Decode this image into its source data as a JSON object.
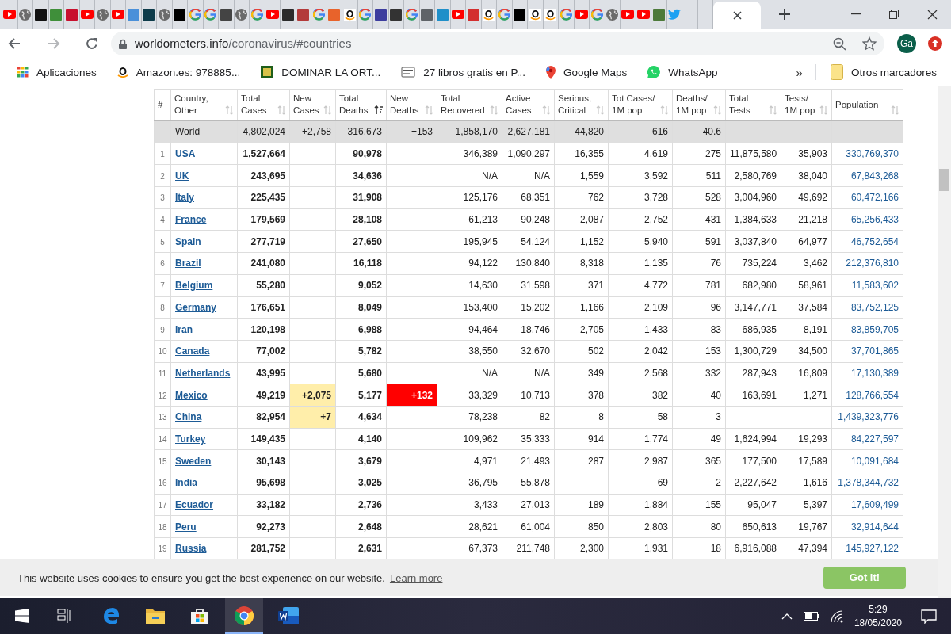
{
  "tabs": [
    {
      "kind": "youtube",
      "selected": false
    },
    {
      "kind": "globe",
      "selected": false
    },
    {
      "kind": "square",
      "color": "#111111",
      "selected": false
    },
    {
      "kind": "square",
      "color": "#3f8f3a",
      "selected": false
    },
    {
      "kind": "square",
      "color": "#c8102e",
      "selected": false
    },
    {
      "kind": "youtube",
      "selected": false
    },
    {
      "kind": "globe",
      "selected": false
    },
    {
      "kind": "youtube",
      "selected": false
    },
    {
      "kind": "square",
      "color": "#4a90d9",
      "selected": false
    },
    {
      "kind": "square",
      "color": "#0d3b4a",
      "selected": false
    },
    {
      "kind": "globe",
      "selected": false
    },
    {
      "kind": "square",
      "color": "#000000",
      "selected": false
    },
    {
      "kind": "google",
      "selected": false
    },
    {
      "kind": "google",
      "selected": false
    },
    {
      "kind": "square",
      "color": "#444444",
      "selected": false
    },
    {
      "kind": "globe",
      "selected": false
    },
    {
      "kind": "google",
      "selected": false
    },
    {
      "kind": "youtube",
      "selected": false
    },
    {
      "kind": "square",
      "color": "#2b2b2b",
      "selected": false
    },
    {
      "kind": "square",
      "color": "#b33a3a",
      "selected": false
    },
    {
      "kind": "google",
      "selected": false
    },
    {
      "kind": "square",
      "color": "#e8632b",
      "selected": false
    },
    {
      "kind": "amazon",
      "selected": false
    },
    {
      "kind": "google",
      "selected": false
    },
    {
      "kind": "square",
      "color": "#3d3d9e",
      "selected": false
    },
    {
      "kind": "square",
      "color": "#333333",
      "selected": false
    },
    {
      "kind": "google",
      "selected": false
    },
    {
      "kind": "square",
      "color": "#5f6368",
      "selected": false
    },
    {
      "kind": "square",
      "color": "#1f8fc9",
      "selected": false
    },
    {
      "kind": "youtube",
      "selected": false
    },
    {
      "kind": "square",
      "color": "#d32f2f",
      "selected": false
    },
    {
      "kind": "amazon",
      "selected": false
    },
    {
      "kind": "google",
      "selected": false
    },
    {
      "kind": "square",
      "color": "#000000",
      "selected": false
    },
    {
      "kind": "amazon",
      "selected": false
    },
    {
      "kind": "amazon",
      "selected": false
    },
    {
      "kind": "google",
      "selected": false
    },
    {
      "kind": "youtube",
      "selected": false
    },
    {
      "kind": "google",
      "selected": false
    },
    {
      "kind": "globe",
      "selected": false
    },
    {
      "kind": "youtube",
      "selected": false
    },
    {
      "kind": "youtube",
      "selected": false
    },
    {
      "kind": "square",
      "color": "#4d7a3a",
      "selected": false
    },
    {
      "kind": "twitter",
      "selected": false
    },
    {
      "kind": "blank",
      "selected": false
    },
    {
      "kind": "blank",
      "selected": false
    },
    {
      "kind": "blank",
      "selected": true
    }
  ],
  "address": {
    "host": "worldometers.info",
    "path": "/coronavirus/#countries"
  },
  "profile": "Ga",
  "bookmarks": [
    {
      "kind": "apps",
      "label": "Aplicaciones"
    },
    {
      "kind": "amazon",
      "label": "Amazon.es: 978885..."
    },
    {
      "kind": "book",
      "label": "DOMINAR LA ORT..."
    },
    {
      "kind": "ebook",
      "label": "27 libros gratis en P..."
    },
    {
      "kind": "maps",
      "label": "Google Maps"
    },
    {
      "kind": "whatsapp",
      "label": "WhatsApp"
    }
  ],
  "more_bookmarks": "»",
  "other_bookmarks": "Otros marcadores",
  "table": {
    "columns": [
      {
        "label": "#",
        "sorted": false
      },
      {
        "label": "Country,\nOther",
        "sorted": false
      },
      {
        "label": "Total\nCases",
        "sorted": false
      },
      {
        "label": "New\nCases",
        "sorted": false
      },
      {
        "label": "Total\nDeaths",
        "sorted": true
      },
      {
        "label": "New\nDeaths",
        "sorted": false
      },
      {
        "label": "Total\nRecovered",
        "sorted": false
      },
      {
        "label": "Active\nCases",
        "sorted": false
      },
      {
        "label": "Serious,\nCritical",
        "sorted": false
      },
      {
        "label": "Tot Cases/\n1M pop",
        "sorted": false
      },
      {
        "label": "Deaths/\n1M pop",
        "sorted": false
      },
      {
        "label": "Total\nTests",
        "sorted": false
      },
      {
        "label": "Tests/\n1M pop",
        "sorted": false
      },
      {
        "label": "Population",
        "sorted": false
      }
    ],
    "rows": [
      {
        "kind": "total",
        "cells": [
          null,
          "World",
          "4,802,024",
          "+2,758",
          "316,673",
          "+153",
          "1,858,170",
          "2,627,181",
          "44,820",
          "616",
          "40.6",
          null,
          null,
          null
        ]
      },
      {
        "kind": "country",
        "cells": [
          "1",
          "USA",
          "1,527,664",
          null,
          "90,978",
          null,
          "346,389",
          "1,090,297",
          "16,355",
          "4,619",
          "275",
          "11,875,580",
          "35,903",
          "330,769,370"
        ]
      },
      {
        "kind": "country",
        "cells": [
          "2",
          "UK",
          "243,695",
          null,
          "34,636",
          null,
          "N/A",
          "N/A",
          "1,559",
          "3,592",
          "511",
          "2,580,769",
          "38,040",
          "67,843,268"
        ]
      },
      {
        "kind": "country",
        "cells": [
          "3",
          "Italy",
          "225,435",
          null,
          "31,908",
          null,
          "125,176",
          "68,351",
          "762",
          "3,728",
          "528",
          "3,004,960",
          "49,692",
          "60,472,166"
        ]
      },
      {
        "kind": "country",
        "cells": [
          "4",
          "France",
          "179,569",
          null,
          "28,108",
          null,
          "61,213",
          "90,248",
          "2,087",
          "2,752",
          "431",
          "1,384,633",
          "21,218",
          "65,256,433"
        ]
      },
      {
        "kind": "country",
        "cells": [
          "5",
          "Spain",
          "277,719",
          null,
          "27,650",
          null,
          "195,945",
          "54,124",
          "1,152",
          "5,940",
          "591",
          "3,037,840",
          "64,977",
          "46,752,654"
        ]
      },
      {
        "kind": "country",
        "cells": [
          "6",
          "Brazil",
          "241,080",
          null,
          "16,118",
          null,
          "94,122",
          "130,840",
          "8,318",
          "1,135",
          "76",
          "735,224",
          "3,462",
          "212,376,810"
        ]
      },
      {
        "kind": "country",
        "cells": [
          "7",
          "Belgium",
          "55,280",
          null,
          "9,052",
          null,
          "14,630",
          "31,598",
          "371",
          "4,772",
          "781",
          "682,980",
          "58,961",
          "11,583,602"
        ]
      },
      {
        "kind": "country",
        "cells": [
          "8",
          "Germany",
          "176,651",
          null,
          "8,049",
          null,
          "153,400",
          "15,202",
          "1,166",
          "2,109",
          "96",
          "3,147,771",
          "37,584",
          "83,752,125"
        ]
      },
      {
        "kind": "country",
        "cells": [
          "9",
          "Iran",
          "120,198",
          null,
          "6,988",
          null,
          "94,464",
          "18,746",
          "2,705",
          "1,433",
          "83",
          "686,935",
          "8,191",
          "83,859,705"
        ]
      },
      {
        "kind": "country",
        "cells": [
          "10",
          "Canada",
          "77,002",
          null,
          "5,782",
          null,
          "38,550",
          "32,670",
          "502",
          "2,042",
          "153",
          "1,300,729",
          "34,500",
          "37,701,865"
        ]
      },
      {
        "kind": "country",
        "cells": [
          "11",
          "Netherlands",
          "43,995",
          null,
          "5,680",
          null,
          "N/A",
          "N/A",
          "349",
          "2,568",
          "332",
          "287,943",
          "16,809",
          "17,130,389"
        ]
      },
      {
        "kind": "country",
        "cells": [
          "12",
          "Mexico",
          "49,219",
          "+2,075",
          "5,177",
          "+132",
          "33,329",
          "10,713",
          "378",
          "382",
          "40",
          "163,691",
          "1,271",
          "128,766,554"
        ]
      },
      {
        "kind": "country",
        "cells": [
          "13",
          "China",
          "82,954",
          "+7",
          "4,634",
          null,
          "78,238",
          "82",
          "8",
          "58",
          "3",
          null,
          null,
          "1,439,323,776"
        ]
      },
      {
        "kind": "country",
        "cells": [
          "14",
          "Turkey",
          "149,435",
          null,
          "4,140",
          null,
          "109,962",
          "35,333",
          "914",
          "1,774",
          "49",
          "1,624,994",
          "19,293",
          "84,227,597"
        ]
      },
      {
        "kind": "country",
        "cells": [
          "15",
          "Sweden",
          "30,143",
          null,
          "3,679",
          null,
          "4,971",
          "21,493",
          "287",
          "2,987",
          "365",
          "177,500",
          "17,589",
          "10,091,684"
        ]
      },
      {
        "kind": "country",
        "cells": [
          "16",
          "India",
          "95,698",
          null,
          "3,025",
          null,
          "36,795",
          "55,878",
          null,
          "69",
          "2",
          "2,227,642",
          "1,616",
          "1,378,344,732"
        ]
      },
      {
        "kind": "country",
        "cells": [
          "17",
          "Ecuador",
          "33,182",
          null,
          "2,736",
          null,
          "3,433",
          "27,013",
          "189",
          "1,884",
          "155",
          "95,047",
          "5,397",
          "17,609,499"
        ]
      },
      {
        "kind": "country",
        "cells": [
          "18",
          "Peru",
          "92,273",
          null,
          "2,648",
          null,
          "28,621",
          "61,004",
          "850",
          "2,803",
          "80",
          "650,613",
          "19,767",
          "32,914,644"
        ]
      },
      {
        "kind": "country",
        "cells": [
          "19",
          "Russia",
          "281,752",
          null,
          "2,631",
          null,
          "67,373",
          "211,748",
          "2,300",
          "1,931",
          "18",
          "6,916,088",
          "47,394",
          "145,927,122"
        ]
      }
    ]
  },
  "cookie_bar": {
    "message": "This website uses cookies to ensure you get the best experience on our website.",
    "link": "Learn more",
    "button": "Got it!"
  },
  "taskbar": {
    "apps": [
      {
        "kind": "start",
        "selected": false
      },
      {
        "kind": "taskview",
        "selected": false
      },
      {
        "kind": "edge",
        "selected": false
      },
      {
        "kind": "explorer",
        "selected": false
      },
      {
        "kind": "store",
        "selected": false
      },
      {
        "kind": "chrome",
        "selected": true
      },
      {
        "kind": "word",
        "selected": false
      }
    ],
    "time": "5:29",
    "date": "18/05/2020"
  }
}
